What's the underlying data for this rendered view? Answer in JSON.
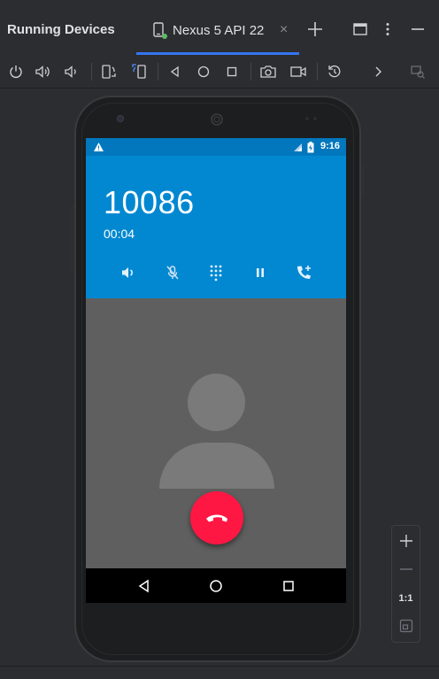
{
  "panel": {
    "title": "Running Devices",
    "tab_label": "Nexus 5 API 22",
    "tab_close": "×"
  },
  "toolbar": {
    "icons": [
      "power-icon",
      "volume-up-icon",
      "volume-down-icon",
      "rotate-left-icon",
      "rotate-right-icon",
      "back-icon",
      "home-icon",
      "overview-icon",
      "screenshot-icon",
      "screen-record-icon",
      "reset-icon",
      "more-chevron-icon",
      "device-mirror-icon"
    ]
  },
  "device": {
    "status_time": "9:16",
    "call_number": "10086",
    "call_timer": "00:04",
    "call_controls": [
      "speaker-icon",
      "mute-icon",
      "dialpad-icon",
      "hold-icon",
      "add-call-icon"
    ]
  },
  "zoom": {
    "actual_size_label": "1:1"
  },
  "colors": {
    "accent": "#3574f0",
    "call_header": "#0288d1",
    "status_bar": "#0277bd",
    "end_call": "#ff1744"
  }
}
